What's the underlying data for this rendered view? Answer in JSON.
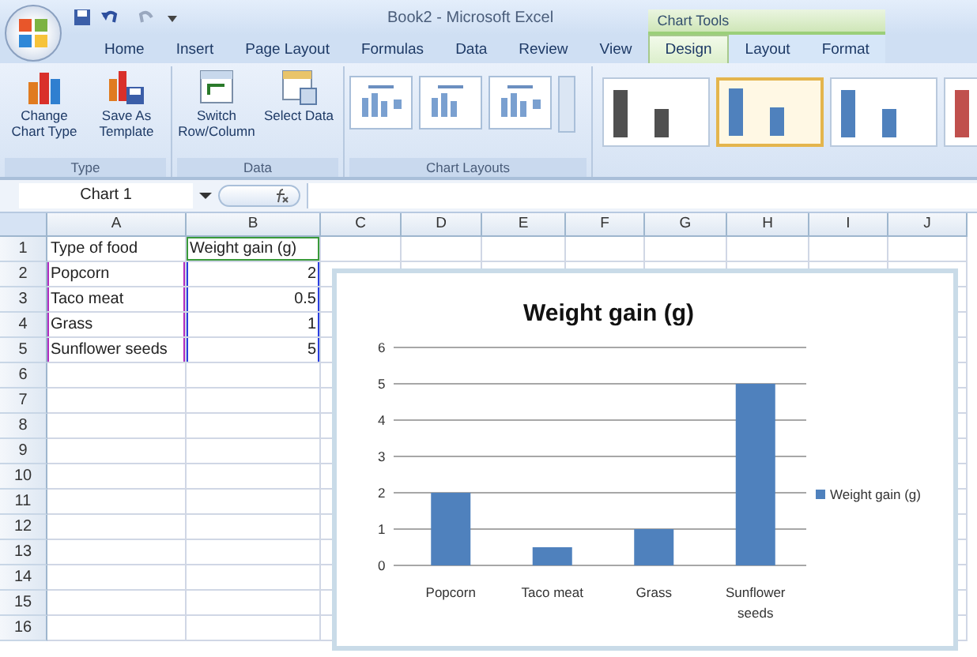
{
  "window": {
    "title": "Book2 - Microsoft Excel"
  },
  "tabs": [
    {
      "label": "Home",
      "selected": false
    },
    {
      "label": "Insert",
      "selected": false
    },
    {
      "label": "Page Layout",
      "selected": false
    },
    {
      "label": "Formulas",
      "selected": false
    },
    {
      "label": "Data",
      "selected": false
    },
    {
      "label": "Review",
      "selected": false
    },
    {
      "label": "View",
      "selected": false
    }
  ],
  "contextual_group": {
    "label": "Chart Tools",
    "tabs": [
      {
        "label": "Design",
        "selected": true
      },
      {
        "label": "Layout",
        "selected": false
      },
      {
        "label": "Format",
        "selected": false
      }
    ]
  },
  "ribbon_groups": [
    {
      "label": "Type",
      "buttons": [
        "Change Chart Type",
        "Save As Template"
      ]
    },
    {
      "label": "Data",
      "buttons": [
        "Switch Row/Column",
        "Select Data"
      ]
    }
  ],
  "chart_layouts": {
    "label": "Chart Layouts"
  },
  "chart_styles": [
    {
      "color": "#505050",
      "selected": false
    },
    {
      "color": "#4f81bd",
      "selected": true
    },
    {
      "color": "#4f81bd",
      "selected": false
    },
    {
      "color": "#c0504d",
      "selected": false
    }
  ],
  "name_box": "Chart 1",
  "columns": [
    "A",
    "B",
    "C",
    "D",
    "E",
    "F",
    "G",
    "H",
    "I",
    "J"
  ],
  "rows": [
    {
      "number": "1",
      "cells": [
        {
          "text": "Type of food",
          "kind": "text"
        },
        {
          "text": "Weight gain (g)",
          "kind": "text"
        }
      ]
    },
    {
      "number": "2",
      "cells": [
        {
          "text": "Popcorn",
          "kind": "text"
        },
        {
          "text": "2",
          "kind": "number"
        }
      ]
    },
    {
      "number": "3",
      "cells": [
        {
          "text": "Taco meat",
          "kind": "text"
        },
        {
          "text": "0.5",
          "kind": "number"
        }
      ]
    },
    {
      "number": "4",
      "cells": [
        {
          "text": "Grass",
          "kind": "text"
        },
        {
          "text": "1",
          "kind": "number"
        }
      ]
    },
    {
      "number": "5",
      "cells": [
        {
          "text": "Sunflower seeds",
          "kind": "text"
        },
        {
          "text": "5",
          "kind": "number"
        }
      ]
    },
    {
      "number": "6",
      "cells": []
    },
    {
      "number": "7",
      "cells": []
    },
    {
      "number": "8",
      "cells": []
    },
    {
      "number": "9",
      "cells": []
    },
    {
      "number": "10",
      "cells": []
    },
    {
      "number": "11",
      "cells": []
    },
    {
      "number": "12",
      "cells": []
    },
    {
      "number": "13",
      "cells": []
    },
    {
      "number": "14",
      "cells": []
    },
    {
      "number": "15",
      "cells": []
    },
    {
      "number": "16",
      "cells": []
    }
  ],
  "chart": {
    "chart_data": {
      "type": "bar",
      "title": "Weight gain (g)",
      "categories": [
        "Popcorn",
        "Taco meat",
        "Grass",
        "Sunflower seeds"
      ],
      "series": [
        {
          "name": "Weight gain (g)",
          "color": "#4f81bd",
          "values": [
            2,
            0.5,
            1,
            5
          ]
        }
      ],
      "ylim": [
        0,
        6
      ],
      "grid": true,
      "yticks": [
        0,
        1,
        2,
        3,
        4,
        5,
        6
      ]
    }
  }
}
